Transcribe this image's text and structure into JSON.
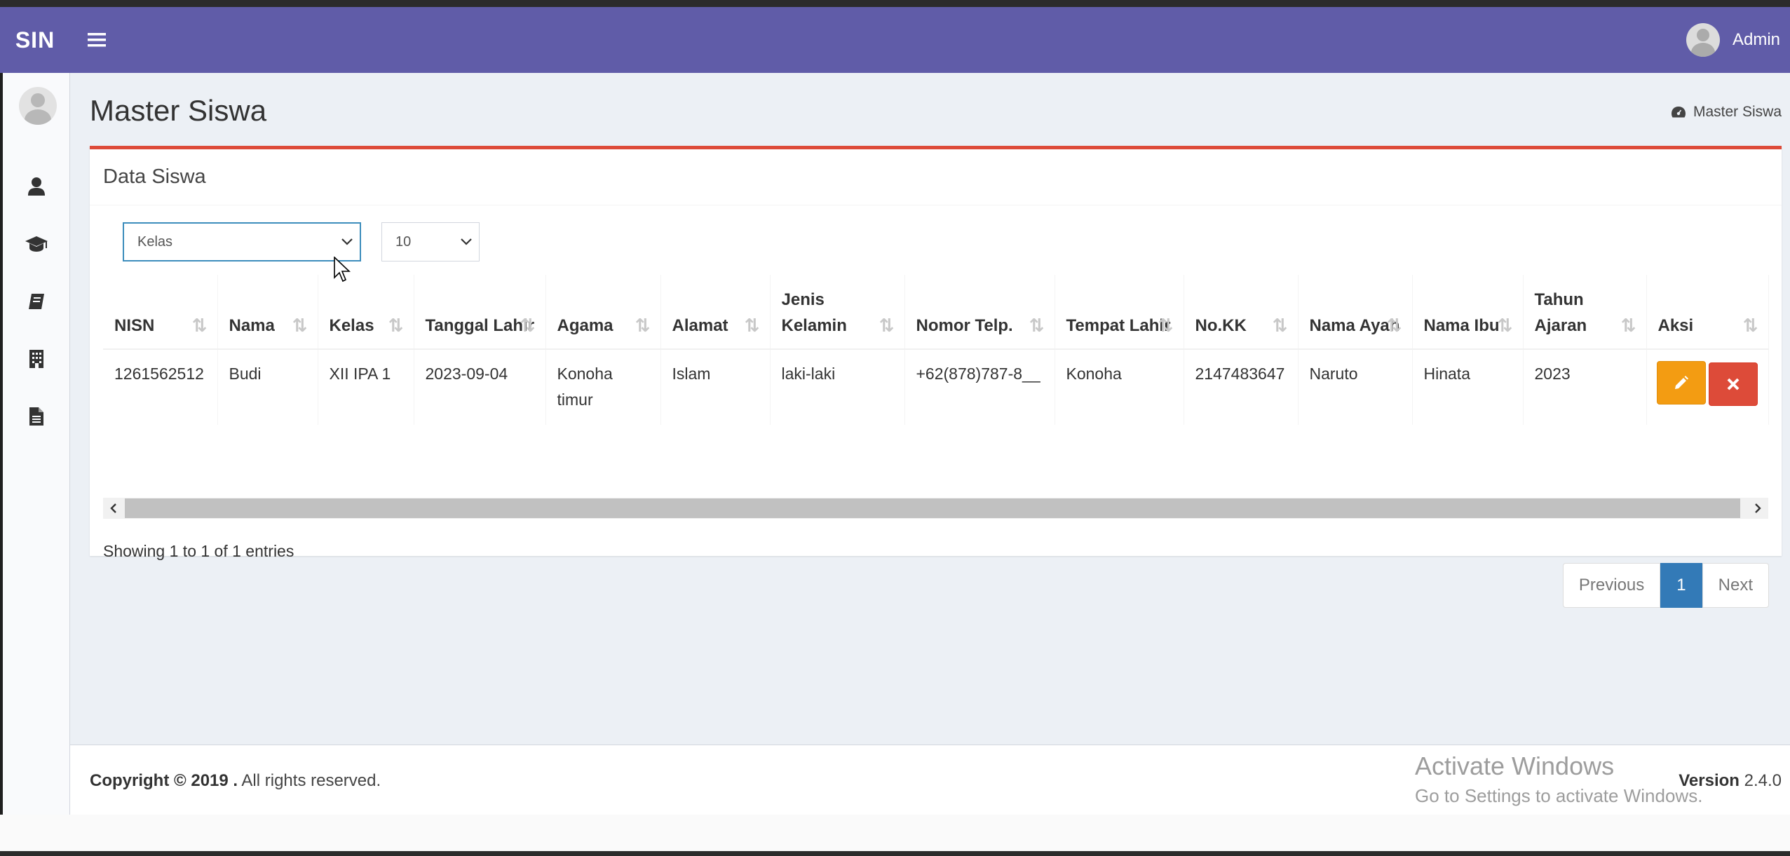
{
  "navbar": {
    "brand": "SIN",
    "user_name": "Admin"
  },
  "sidebar": {
    "items": [
      {
        "icon": "user-icon"
      },
      {
        "icon": "graduation-cap-icon"
      },
      {
        "icon": "book-icon"
      },
      {
        "icon": "building-icon"
      },
      {
        "icon": "file-icon"
      }
    ]
  },
  "page": {
    "title": "Master Siswa",
    "breadcrumb": "Master Siswa"
  },
  "box": {
    "title": "Data Siswa"
  },
  "filters": {
    "kelas_selected": "Kelas",
    "page_size_selected": "10"
  },
  "table": {
    "headers": [
      "NISN",
      "Nama",
      "Kelas",
      "Tanggal Lahir",
      "Agama",
      "Alamat",
      "Jenis Kelamin",
      "Nomor Telp.",
      "Tempat Lahir",
      "No.KK",
      "Nama Ayah",
      "Nama Ibu",
      "Tahun Ajaran",
      "Aksi"
    ],
    "rows": [
      {
        "nisn": "1261562512",
        "nama": "Budi",
        "kelas": "XII IPA 1",
        "tanggal_lahir": "2023-09-04",
        "agama": "Konoha timur",
        "alamat": "Islam",
        "jenis_kelamin": "laki-laki",
        "nomor_telp": "+62(878)787-8__",
        "tempat_lahir": "Konoha",
        "no_kk": "2147483647",
        "nama_ayah": "Naruto",
        "nama_ibu": "Hinata",
        "tahun_ajaran": "2023"
      }
    ]
  },
  "table_info": "Showing 1 to 1 of 1 entries",
  "pagination": {
    "previous": "Previous",
    "current": "1",
    "next": "Next"
  },
  "footer": {
    "copyright_bold": "Copyright © 2019 .",
    "copyright_rest": " All rights reserved.",
    "version_label": "Version",
    "version_number": " 2.4.0"
  },
  "watermark": {
    "line1": "Activate Windows",
    "line2": "Go to Settings to activate Windows."
  },
  "colors": {
    "navbar": "#605ca8",
    "box_accent": "#dd4b39",
    "edit_button": "#f39c12",
    "delete_button": "#dd4b39",
    "pagination_active": "#337ab7"
  }
}
